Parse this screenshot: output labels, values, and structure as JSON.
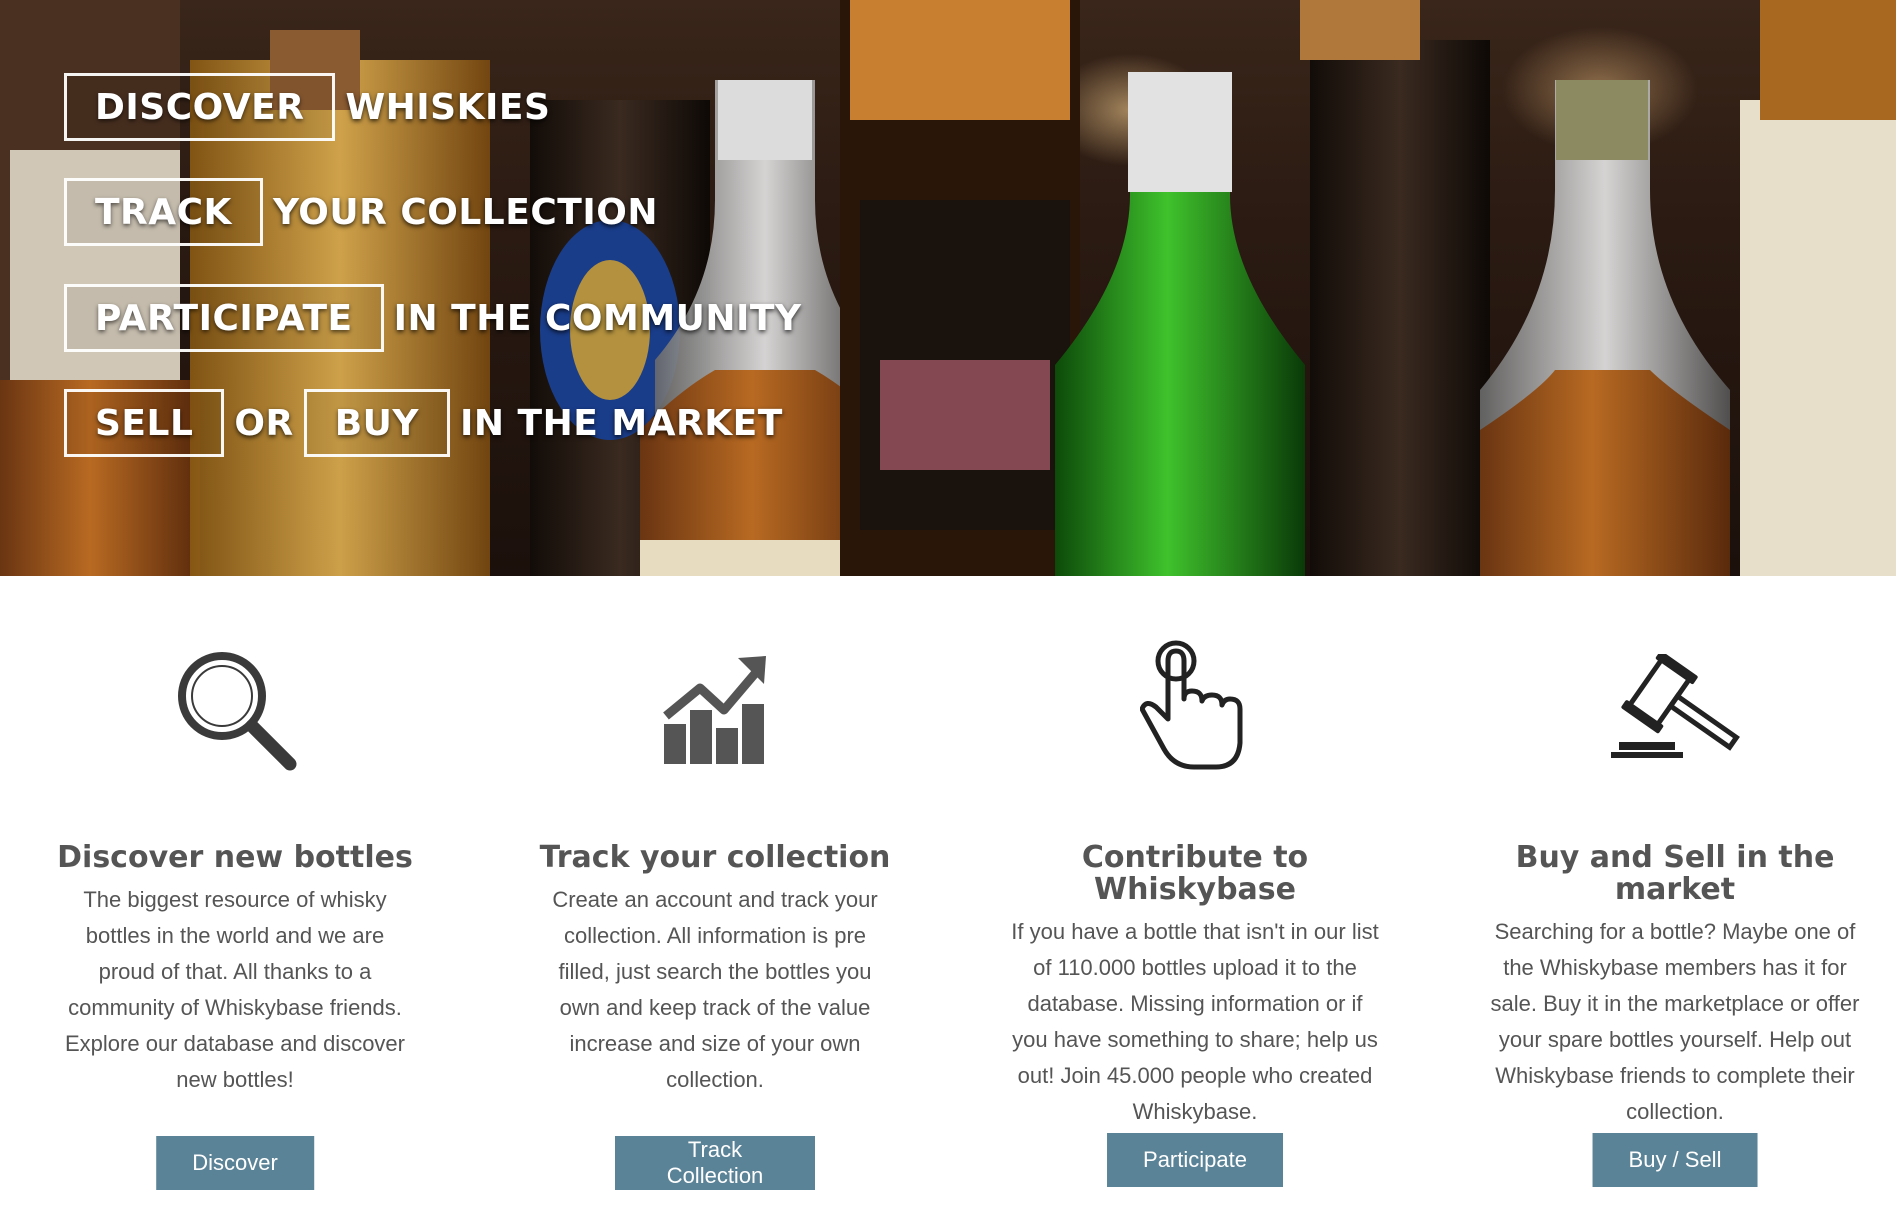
{
  "hero": {
    "lines": [
      {
        "boxed": "DISCOVER",
        "text": "WHISKIES"
      },
      {
        "boxed": "TRACK",
        "text": "YOUR COLLECTION"
      },
      {
        "boxed": "PARTICIPATE",
        "text": "IN THE COMMUNITY"
      },
      {
        "boxed": "SELL",
        "middle": "OR",
        "boxed2": "BUY",
        "text": "IN THE MARKET"
      }
    ]
  },
  "features": [
    {
      "icon": "magnifier-icon",
      "title": "Discover new bottles",
      "description": "The biggest resource of whisky bottles in the world and we are proud of that. All thanks to a community of Whiskybase friends. Explore our database and discover new bottles!",
      "button": "Discover"
    },
    {
      "icon": "rising-chart-icon",
      "title": "Track your collection",
      "description": "Create an account and track your collection. All information is pre filled, just search the bottles you own and keep track of the value increase and size of your own collection.",
      "button": "Track Collection"
    },
    {
      "icon": "pointing-hand-icon",
      "title": "Contribute to Whiskybase",
      "description": "If you have a bottle that isn't in our list of 110.000 bottles upload it to the database. Missing information or if you have something to share; help us out! Join 45.000 people who created Whiskybase.",
      "button": "Participate"
    },
    {
      "icon": "gavel-icon",
      "title": "Buy and Sell in the market",
      "description": "Searching for a bottle? Maybe one of the Whiskybase members has it for sale. Buy it in the marketplace or offer your spare bottles yourself. Help out Whiskybase friends to complete their collection.",
      "button": "Buy / Sell"
    }
  ],
  "colors": {
    "button_bg": "#5b8397",
    "text": "#555555",
    "icon": "#3a3a3a"
  }
}
